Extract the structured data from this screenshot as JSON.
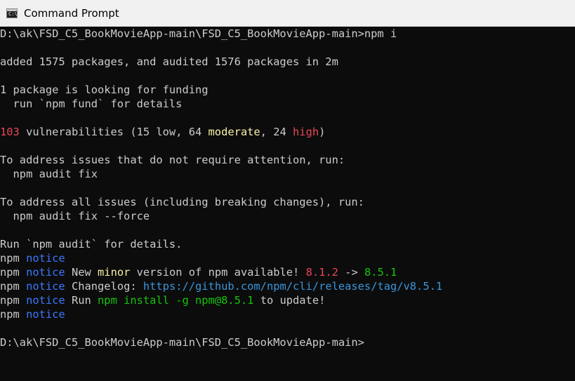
{
  "window": {
    "title": "Command Prompt",
    "icon": "console-icon"
  },
  "colors": {
    "background": "#0c0c0c",
    "default_text": "#cccccc",
    "red": "#e74856",
    "yellow": "#f9f1a5",
    "blue": "#3b78ff",
    "green": "#16c60c",
    "link": "#3a96dd"
  },
  "terminal": {
    "lines": [
      {
        "segments": [
          {
            "text": "D:\\ak\\FSD_C5_BookMovieApp-main\\FSD_C5_BookMovieApp-main>npm i"
          }
        ]
      },
      {
        "segments": [
          {
            "text": ""
          }
        ]
      },
      {
        "segments": [
          {
            "text": "added 1575 packages, and audited 1576 packages in 2m"
          }
        ]
      },
      {
        "segments": [
          {
            "text": ""
          }
        ]
      },
      {
        "segments": [
          {
            "text": "1 package is looking for funding"
          }
        ]
      },
      {
        "segments": [
          {
            "text": "  run `npm fund` for details"
          }
        ]
      },
      {
        "segments": [
          {
            "text": ""
          }
        ]
      },
      {
        "segments": [
          {
            "text": "103",
            "color": "red"
          },
          {
            "text": " vulnerabilities (15 low, 64 "
          },
          {
            "text": "moderate",
            "color": "yellow"
          },
          {
            "text": ", 24 "
          },
          {
            "text": "high",
            "color": "red"
          },
          {
            "text": ")"
          }
        ]
      },
      {
        "segments": [
          {
            "text": ""
          }
        ]
      },
      {
        "segments": [
          {
            "text": "To address issues that do not require attention, run:"
          }
        ]
      },
      {
        "segments": [
          {
            "text": "  npm audit fix"
          }
        ]
      },
      {
        "segments": [
          {
            "text": ""
          }
        ]
      },
      {
        "segments": [
          {
            "text": "To address all issues (including breaking changes), run:"
          }
        ]
      },
      {
        "segments": [
          {
            "text": "  npm audit fix --force"
          }
        ]
      },
      {
        "segments": [
          {
            "text": ""
          }
        ]
      },
      {
        "segments": [
          {
            "text": "Run `npm audit` for details."
          }
        ]
      },
      {
        "segments": [
          {
            "text": "npm "
          },
          {
            "text": "notice",
            "color": "blue"
          }
        ]
      },
      {
        "segments": [
          {
            "text": "npm "
          },
          {
            "text": "notice",
            "color": "blue"
          },
          {
            "text": " New "
          },
          {
            "text": "minor",
            "color": "yellow"
          },
          {
            "text": " version of npm available! "
          },
          {
            "text": "8.1.2",
            "color": "red"
          },
          {
            "text": " -> "
          },
          {
            "text": "8.5.1",
            "color": "green"
          }
        ]
      },
      {
        "segments": [
          {
            "text": "npm "
          },
          {
            "text": "notice",
            "color": "blue"
          },
          {
            "text": " Changelog: "
          },
          {
            "text": "https://github.com/npm/cli/releases/tag/v8.5.1",
            "color": "link"
          }
        ]
      },
      {
        "segments": [
          {
            "text": "npm "
          },
          {
            "text": "notice",
            "color": "blue"
          },
          {
            "text": " Run "
          },
          {
            "text": "npm install -g npm@8.5.1",
            "color": "green"
          },
          {
            "text": " to update!"
          }
        ]
      },
      {
        "segments": [
          {
            "text": "npm "
          },
          {
            "text": "notice",
            "color": "blue"
          }
        ]
      },
      {
        "segments": [
          {
            "text": ""
          }
        ]
      },
      {
        "segments": [
          {
            "text": "D:\\ak\\FSD_C5_BookMovieApp-main\\FSD_C5_BookMovieApp-main>"
          }
        ]
      }
    ]
  }
}
